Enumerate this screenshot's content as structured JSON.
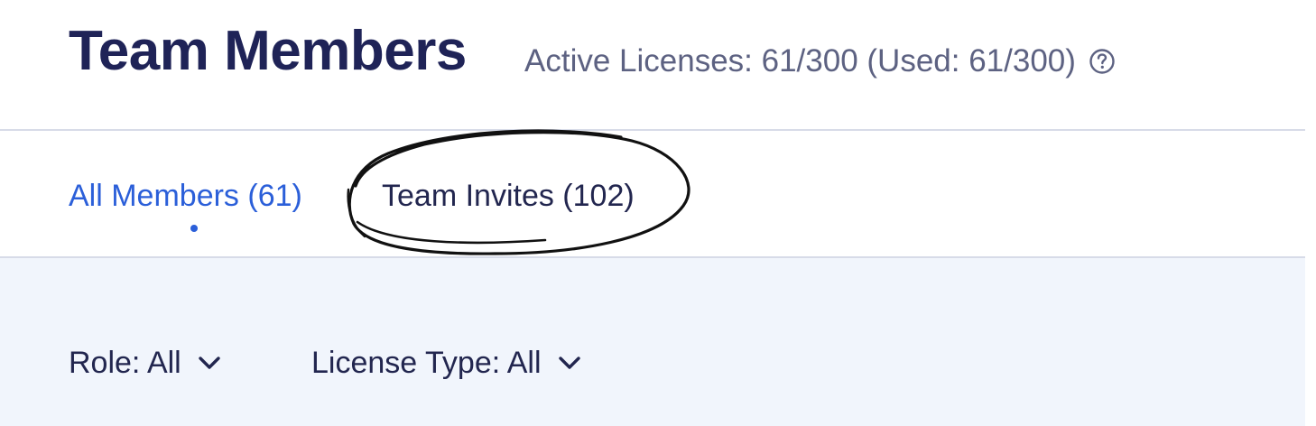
{
  "header": {
    "title": "Team Members",
    "licenses_text": "Active Licenses: 61/300 (Used: 61/300)",
    "help_icon": "question-circle-icon"
  },
  "tabs": [
    {
      "label": "All Members (61)",
      "active": true
    },
    {
      "label": "Team Invites (102)",
      "active": false
    }
  ],
  "filters": [
    {
      "label": "Role: All",
      "icon": "chevron-down-icon"
    },
    {
      "label": "License Type: All",
      "icon": "chevron-down-icon"
    }
  ],
  "colors": {
    "title": "#1f2357",
    "active_tab": "#2b5fd9",
    "text": "#22264f",
    "muted": "#5d6282",
    "filter_bg": "#f1f5fc",
    "divider": "#d7dbe8"
  }
}
